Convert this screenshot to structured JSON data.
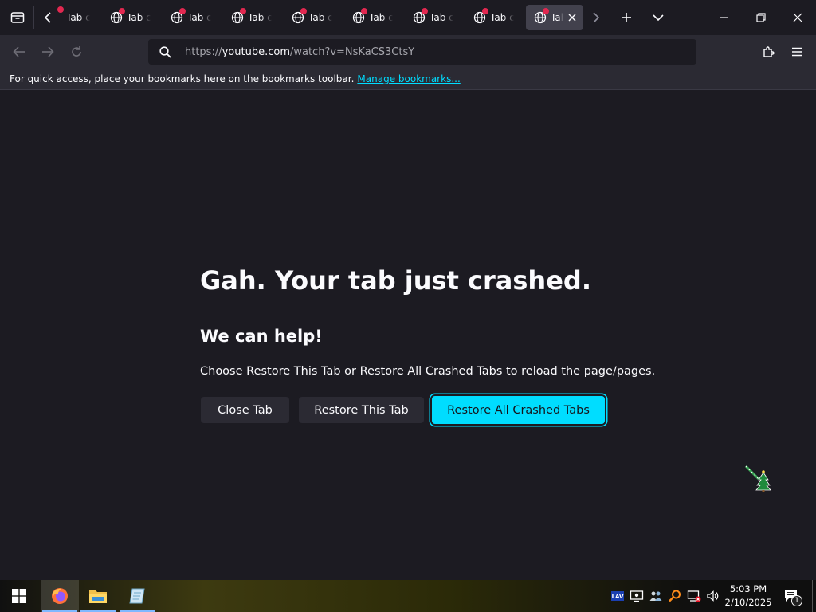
{
  "tabs": [
    {
      "title": "Tab crashed"
    },
    {
      "title": "Tab crashed"
    },
    {
      "title": "Tab crashed"
    },
    {
      "title": "Tab crashed"
    },
    {
      "title": "Tab crashed"
    },
    {
      "title": "Tab crashed"
    },
    {
      "title": "Tab crashed"
    },
    {
      "title": "Tab crashed"
    },
    {
      "title": "Tab crashed"
    }
  ],
  "active_tab": {
    "title": "Tab crashed"
  },
  "urlbar": {
    "prefix": "https://",
    "host": "youtube.com",
    "path": "/watch?v=NsKaCS3CtsY"
  },
  "bookmarks_bar": {
    "message": "For quick access, place your bookmarks here on the bookmarks toolbar.",
    "link": "Manage bookmarks..."
  },
  "crash_page": {
    "title": "Gah. Your tab just crashed.",
    "subtitle": "We can help!",
    "description": "Choose Restore This Tab or Restore All Crashed Tabs to reload the page/pages.",
    "close_label": "Close Tab",
    "restore_label": "Restore This Tab",
    "restore_all_label": "Restore All Crashed Tabs"
  },
  "taskbar": {
    "apps": [
      "firefox-icon",
      "file-explorer-icon",
      "notepad-icon"
    ],
    "tray_icons": [
      "lav-icon",
      "display-icon",
      "network-people-icon",
      "search-tool-icon",
      "network-icon",
      "volume-icon"
    ],
    "time": "5:03 PM",
    "date": "2/10/2025",
    "notification_count": "1"
  },
  "colors": {
    "accent": "#00ddff",
    "background": "#1c1b22",
    "toolbar": "#2b2a33",
    "crash_badge": "#e22850"
  }
}
